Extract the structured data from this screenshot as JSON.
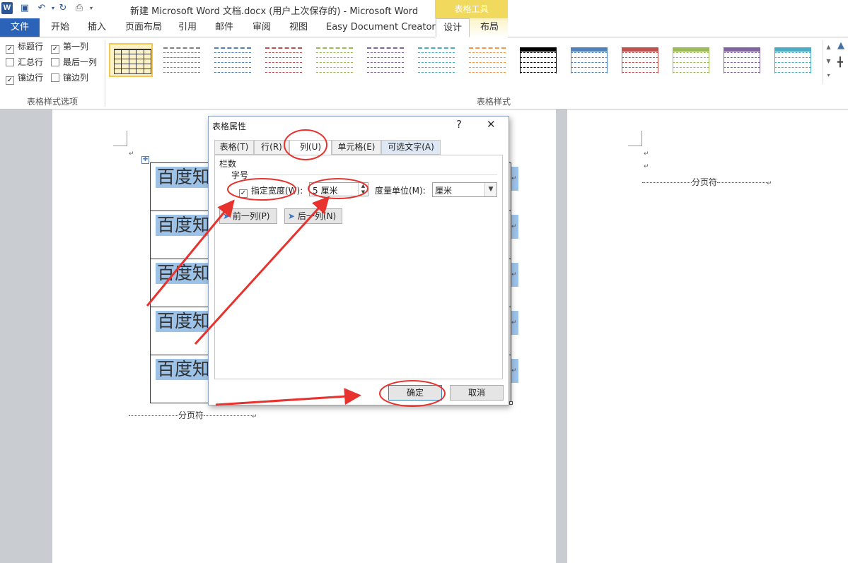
{
  "window": {
    "title": "新建 Microsoft Word 文档.docx (用户上次保存的) - Microsoft Word",
    "contextual_tab_group": "表格工具",
    "app_icon_letter": "W"
  },
  "tabs": {
    "file": "文件",
    "items": [
      "开始",
      "插入",
      "页面布局",
      "引用",
      "邮件",
      "审阅",
      "视图",
      "Easy Document Creator"
    ],
    "design": "设计",
    "layout": "布局"
  },
  "ribbon": {
    "style_options": {
      "header_row": {
        "label": "标题行",
        "checked": true
      },
      "first_column": {
        "label": "第一列",
        "checked": true
      },
      "total_row": {
        "label": "汇总行",
        "checked": false
      },
      "last_column": {
        "label": "最后一列",
        "checked": false
      },
      "banded_rows": {
        "label": "镶边行",
        "checked": true
      },
      "banded_columns": {
        "label": "镶边列",
        "checked": false
      },
      "group_label": "表格样式选项"
    },
    "table_styles": {
      "group_label": "表格样式",
      "swatch_colors": [
        "#333333",
        "#808080",
        "#4f81bd",
        "#c0504d",
        "#9bbb59",
        "#8064a2",
        "#4bacc6",
        "#f79646",
        "#000000",
        "#4f81bd",
        "#c0504d",
        "#9bbb59",
        "#8064a2",
        "#4bacc6"
      ]
    }
  },
  "document": {
    "cell_text": "百度知",
    "row_count": 5,
    "page_break_label": "分页符"
  },
  "dialog": {
    "title": "表格属性",
    "help": "?",
    "close": "✕",
    "tabs": [
      "表格(T)",
      "行(R)",
      "列(U)",
      "单元格(E)",
      "可选文字(A)"
    ],
    "active_tab": "列(U)",
    "section_label": "栏数",
    "field_label": "字号",
    "specify_width": {
      "label": "指定宽度(W):",
      "checked": true
    },
    "width_value": "5 厘米",
    "measure_label": "度量单位(M):",
    "measure_value": "厘米",
    "prev_column": "前一列(P)",
    "next_column": "后一列(N)",
    "ok": "确定",
    "cancel": "取消"
  },
  "annotation_color": "#e8322e"
}
